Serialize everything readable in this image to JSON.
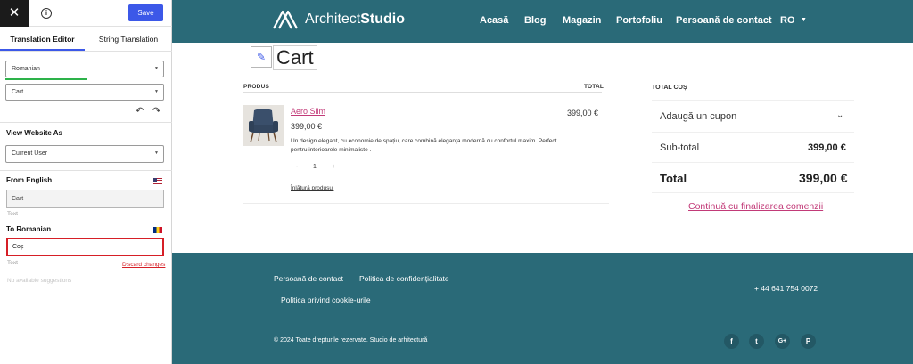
{
  "panel": {
    "close_label": "✕",
    "info_label": "i",
    "save_label": "Save",
    "tabs": [
      {
        "label": "Translation Editor",
        "active": true
      },
      {
        "label": "String Translation",
        "active": false
      }
    ],
    "language_select": "Romanian",
    "string_select": "Cart",
    "undo_label": "↶",
    "redo_label": "↷",
    "view_as_title": "View Website As",
    "view_as_select": "Current User",
    "from_title": "From English",
    "from_value": "Cart",
    "from_hint": "Text",
    "to_title": "To Romanian",
    "to_value": "Coș",
    "to_hint": "Text",
    "discard_label": "Discard changes",
    "suggestions": "No available suggestions",
    "accent_color": "#3c58e8",
    "highlight_color": "#d61f26"
  },
  "site": {
    "brand_regular": "Architect",
    "brand_bold": "Studio",
    "nav": [
      "Acasă",
      "Blog",
      "Magazin",
      "Portofoliu",
      "Persoană de contact",
      "RO"
    ],
    "edit_icon": "pencil-icon",
    "page_title": "Cart",
    "table": {
      "col_product": "PRODUS",
      "col_total": "TOTAL"
    },
    "product": {
      "name": "Aero Slim",
      "price": "399,00 €",
      "description": "Un design elegant, cu economie de spațiu, care combină eleganța modernă cu confortul maxim. Perfect pentru interioarele minimaliste .",
      "qty_minus": "-",
      "qty": "1",
      "qty_plus": "+",
      "remove": "Înlătură produsul",
      "line_total": "399,00 €"
    },
    "totals": {
      "title": "TOTAL COȘ",
      "coupon": "Adaugă un cupon",
      "subtotal_label": "Sub-total",
      "subtotal_value": "399,00 €",
      "total_label": "Total",
      "total_value": "399,00 €",
      "checkout": "Continuă cu finalizarea comenzii"
    },
    "footer": {
      "links": [
        "Persoană de contact",
        "Politica de confidențialitate",
        "Politica privind cookie-urile"
      ],
      "phone": "+ 44 641 754 0072",
      "copyright": "© 2024 Toate drepturile rezervate. Studio de arhitectură",
      "social": [
        "f",
        "t",
        "G+",
        "P"
      ]
    },
    "header_color": "#2a6a78",
    "link_color": "#c23a78"
  }
}
